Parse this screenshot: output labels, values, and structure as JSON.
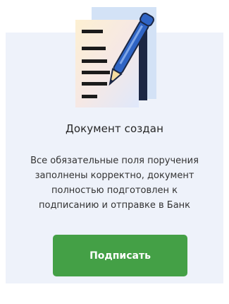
{
  "dialog": {
    "title": "Документ создан",
    "description_lines": [
      "Все обязательные поля поручения",
      "заполнены корректно, документ",
      "полностью подготовлен к",
      "подписанию и отправке в Банк"
    ],
    "sign_button_label": "Подписать"
  },
  "icons": {
    "illustration": "document-with-pen-icon"
  },
  "colors": {
    "card_background": "#eef2fa",
    "button_background": "#44a046",
    "pen_blue": "#2f64c4",
    "dark_navy": "#1b2744"
  }
}
